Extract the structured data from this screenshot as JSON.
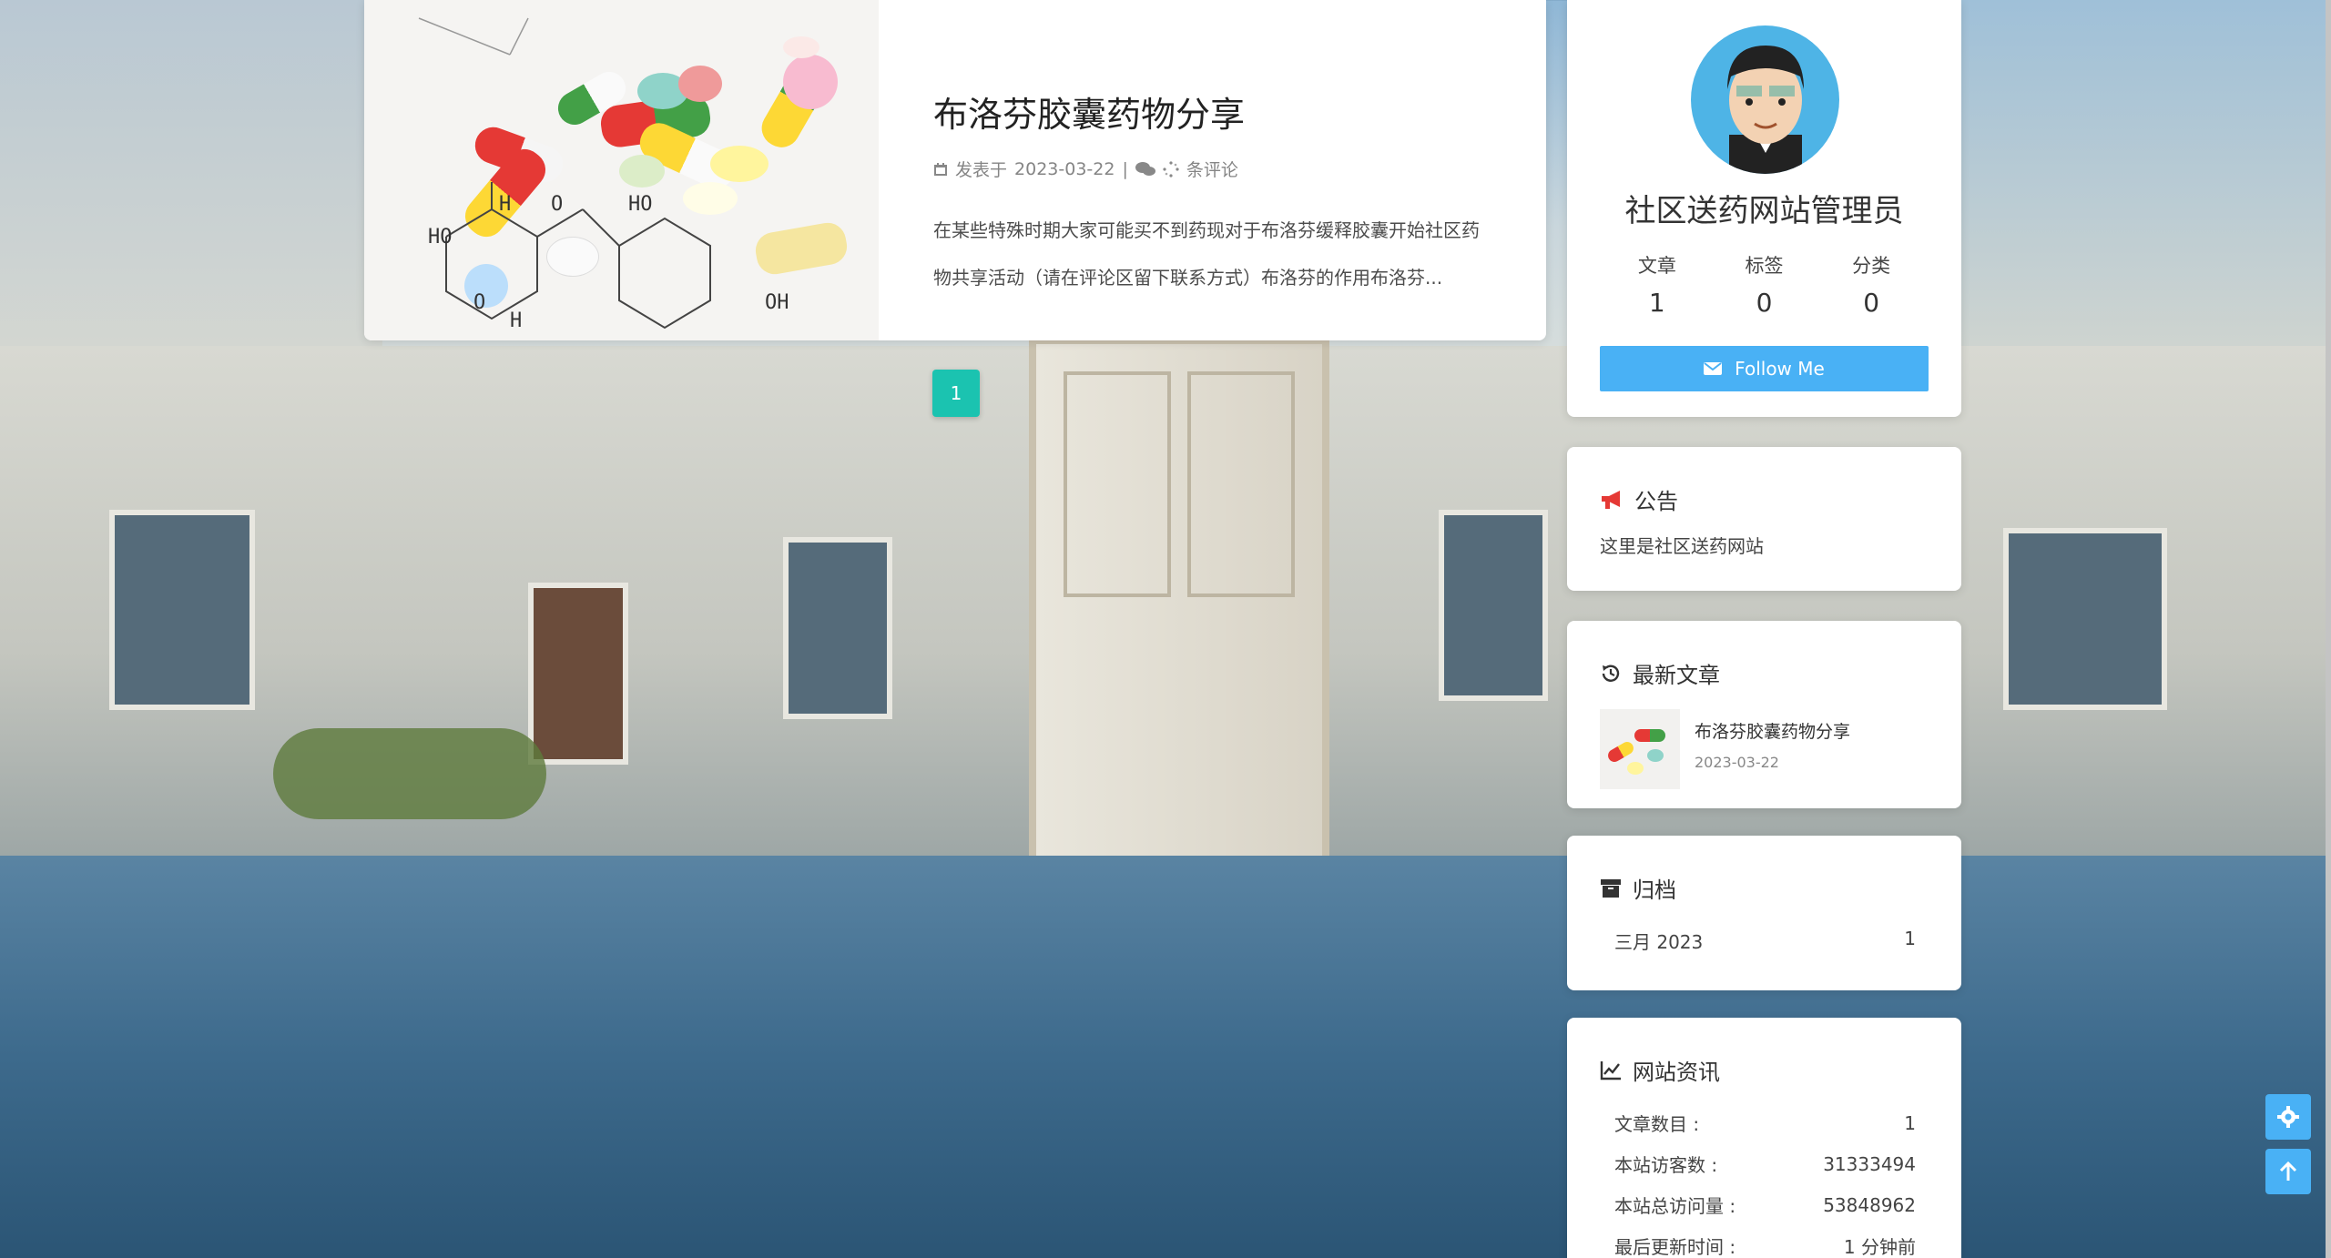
{
  "post": {
    "title": "布洛芬胶囊药物分享",
    "meta_posted_label": "发表于",
    "meta_date": "2023-03-22",
    "meta_separator": "|",
    "meta_comments": "条评论",
    "excerpt": "在某些特殊时期大家可能买不到药现对于布洛芬缓释胶囊开始社区药物共享活动（请在评论区留下联系方式）布洛芬的作用布洛芬...",
    "thumb_labels": [
      "HO",
      "O",
      "H",
      "HO",
      "O",
      "OH",
      "H"
    ]
  },
  "pagination": {
    "current": "1"
  },
  "author": {
    "name": "社区送药网站管理员",
    "stats": [
      {
        "label": "文章",
        "value": "1"
      },
      {
        "label": "标签",
        "value": "0"
      },
      {
        "label": "分类",
        "value": "0"
      }
    ],
    "follow_label": "Follow Me"
  },
  "notice": {
    "title": "公告",
    "text": "这里是社区送药网站"
  },
  "recent": {
    "title": "最新文章",
    "items": [
      {
        "title": "布洛芬胶囊药物分享",
        "date": "2023-03-22"
      }
    ]
  },
  "archive": {
    "title": "归档",
    "items": [
      {
        "label": "三月 2023",
        "count": "1"
      }
    ]
  },
  "site_info": {
    "title": "网站资讯",
    "rows": [
      {
        "label": "文章数目 :",
        "value": "1"
      },
      {
        "label": "本站访客数 :",
        "value": "31333494"
      },
      {
        "label": "本站总访问量 :",
        "value": "53848962"
      },
      {
        "label": "最后更新时间 :",
        "value": "1 分钟前"
      }
    ]
  },
  "colors": {
    "accent": "#49b1f5",
    "pager": "#1bc3b0",
    "notice_icon": "#e53935"
  },
  "icons": {
    "calendar": "calendar-icon",
    "comments": "comments-icon",
    "envelope": "envelope-icon",
    "bullhorn": "bullhorn-icon",
    "history": "history-icon",
    "archive": "archive-icon",
    "chart": "line-chart-icon",
    "gear": "gear-icon",
    "arrow_up": "arrow-up-icon"
  }
}
